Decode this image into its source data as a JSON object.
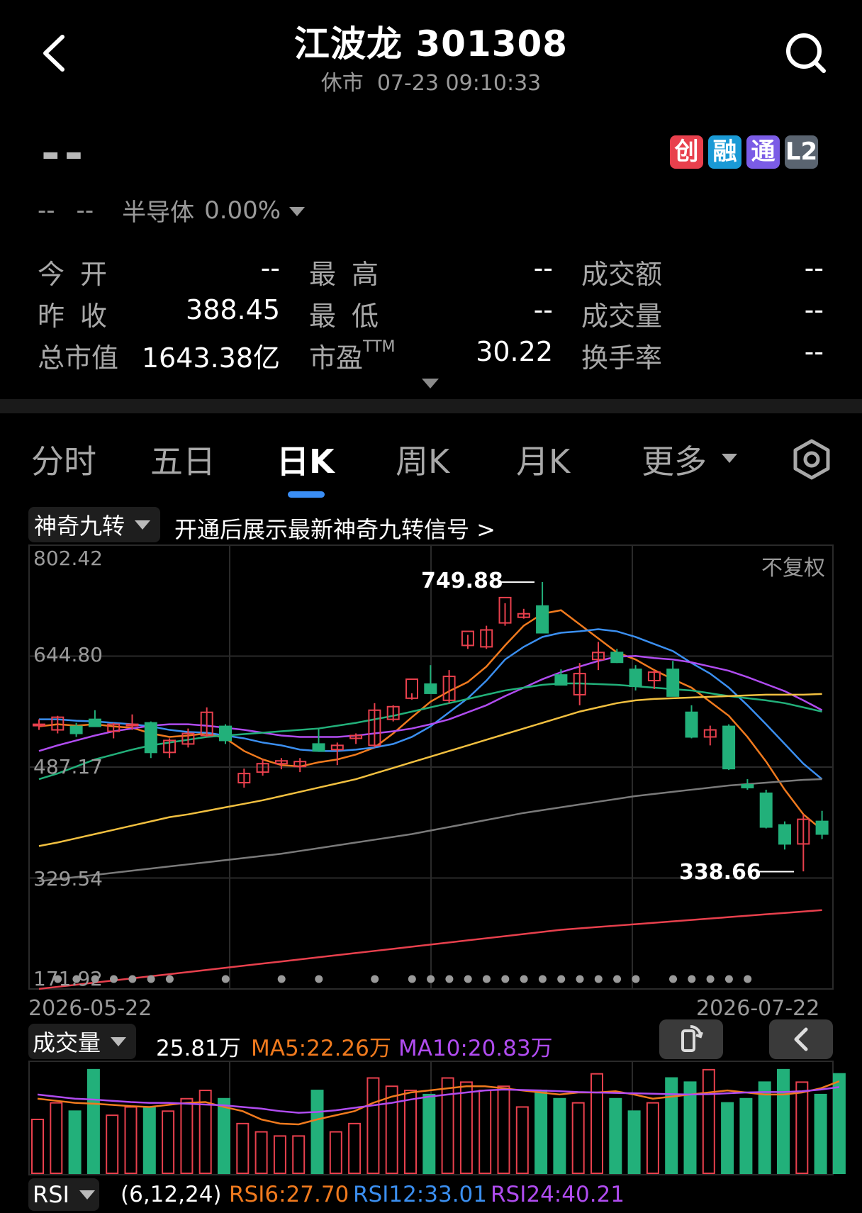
{
  "header": {
    "title": "江波龙 301308",
    "status": "休市",
    "datetime": "07-23 09:10:33"
  },
  "quote": {
    "price": "--",
    "change": "--",
    "change_pct": "--",
    "sector": "半导体",
    "sector_pct": "0.00%",
    "badges": [
      {
        "label": "创",
        "color": "#e8404d"
      },
      {
        "label": "融",
        "color": "#1a9ad6"
      },
      {
        "label": "通",
        "color": "#7b5ce6"
      },
      {
        "label": "L2",
        "color": "#5a6470"
      }
    ],
    "fields": {
      "open_label": "今开",
      "open": "--",
      "high_label": "最高",
      "high": "--",
      "amount_label": "成交额",
      "amount": "--",
      "prev_close_label": "昨收",
      "prev_close": "388.45",
      "low_label": "最低",
      "low": "--",
      "volume_label": "成交量",
      "volume": "--",
      "mktcap_label": "总市值",
      "mktcap": "1643.38亿",
      "pe_label": "市盈",
      "pe_sup": "TTM",
      "pe": "30.22",
      "turnover_label": "换手率",
      "turnover": "--"
    }
  },
  "tabs": [
    "分时",
    "五日",
    "日K",
    "周K",
    "月K",
    "更多"
  ],
  "active_tab": "日K",
  "indicator_bar": {
    "selector": "神奇九转",
    "promo": "开通后展示最新神奇九转信号 >"
  },
  "chart_data": {
    "type": "candlestick",
    "price_axis": [
      "802.42",
      "644.80",
      "487.17",
      "329.54",
      "171.92"
    ],
    "ylim": [
      171.92,
      802.42
    ],
    "adjust_label": "不复权",
    "x_start": "2026-05-22",
    "x_end": "2026-07-22",
    "max_label": "749.88",
    "min_label": "338.66",
    "candles": [
      {
        "o": 548,
        "h": 555,
        "l": 540,
        "c": 548
      },
      {
        "o": 540,
        "h": 560,
        "l": 535,
        "c": 558
      },
      {
        "o": 545,
        "h": 550,
        "l": 530,
        "c": 535
      },
      {
        "o": 555,
        "h": 568,
        "l": 545,
        "c": 545
      },
      {
        "o": 538,
        "h": 550,
        "l": 528,
        "c": 548
      },
      {
        "o": 548,
        "h": 562,
        "l": 540,
        "c": 548
      },
      {
        "o": 550,
        "h": 552,
        "l": 500,
        "c": 508
      },
      {
        "o": 508,
        "h": 528,
        "l": 500,
        "c": 525
      },
      {
        "o": 520,
        "h": 542,
        "l": 515,
        "c": 535
      },
      {
        "o": 532,
        "h": 572,
        "l": 530,
        "c": 565
      },
      {
        "o": 545,
        "h": 548,
        "l": 520,
        "c": 525
      },
      {
        "o": 465,
        "h": 485,
        "l": 458,
        "c": 478
      },
      {
        "o": 480,
        "h": 498,
        "l": 475,
        "c": 492
      },
      {
        "o": 492,
        "h": 500,
        "l": 484,
        "c": 496
      },
      {
        "o": 488,
        "h": 500,
        "l": 480,
        "c": 495
      },
      {
        "o": 520,
        "h": 542,
        "l": 512,
        "c": 510
      },
      {
        "o": 512,
        "h": 522,
        "l": 490,
        "c": 518
      },
      {
        "o": 528,
        "h": 535,
        "l": 520,
        "c": 532
      },
      {
        "o": 518,
        "h": 578,
        "l": 515,
        "c": 568
      },
      {
        "o": 555,
        "h": 575,
        "l": 552,
        "c": 573
      },
      {
        "o": 585,
        "h": 592,
        "l": 583,
        "c": 612
      },
      {
        "o": 605,
        "h": 632,
        "l": 598,
        "c": 592
      },
      {
        "o": 582,
        "h": 625,
        "l": 578,
        "c": 616
      },
      {
        "o": 660,
        "h": 675,
        "l": 655,
        "c": 680
      },
      {
        "o": 658,
        "h": 688,
        "l": 655,
        "c": 682
      },
      {
        "o": 692,
        "h": 720,
        "l": 688,
        "c": 728
      },
      {
        "o": 700,
        "h": 712,
        "l": 698,
        "c": 705
      },
      {
        "o": 716,
        "h": 750,
        "l": 680,
        "c": 678
      },
      {
        "o": 618,
        "h": 626,
        "l": 605,
        "c": 604
      },
      {
        "o": 590,
        "h": 635,
        "l": 575,
        "c": 620
      },
      {
        "o": 640,
        "h": 665,
        "l": 625,
        "c": 650
      },
      {
        "o": 650,
        "h": 655,
        "l": 635,
        "c": 636
      },
      {
        "o": 626,
        "h": 632,
        "l": 596,
        "c": 602
      },
      {
        "o": 610,
        "h": 625,
        "l": 598,
        "c": 622
      },
      {
        "o": 626,
        "h": 638,
        "l": 592,
        "c": 588
      },
      {
        "o": 565,
        "h": 575,
        "l": 528,
        "c": 530
      },
      {
        "o": 530,
        "h": 546,
        "l": 518,
        "c": 540
      },
      {
        "o": 545,
        "h": 548,
        "l": 483,
        "c": 485
      },
      {
        "o": 462,
        "h": 470,
        "l": 455,
        "c": 458
      },
      {
        "o": 450,
        "h": 455,
        "l": 400,
        "c": 402
      },
      {
        "o": 405,
        "h": 410,
        "l": 370,
        "c": 378
      },
      {
        "o": 378,
        "h": 420,
        "l": 339,
        "c": 413
      },
      {
        "o": 410,
        "h": 425,
        "l": 385,
        "c": 392
      }
    ],
    "moving_averages": [
      {
        "name": "MA5",
        "color": "#f07a1e",
        "values": [
          545,
          548,
          546,
          548,
          545,
          543,
          535,
          530,
          532,
          535,
          528,
          510,
          498,
          490,
          488,
          494,
          498,
          505,
          515,
          535,
          558,
          580,
          595,
          608,
          630,
          660,
          688,
          705,
          710,
          690,
          670,
          650,
          640,
          625,
          612,
          600,
          580,
          560,
          530,
          495,
          455,
          420,
          398
        ]
      },
      {
        "name": "MA10",
        "color": "#3b8ff0",
        "values": [
          555,
          555,
          553,
          552,
          550,
          548,
          545,
          540,
          537,
          536,
          532,
          528,
          522,
          518,
          512,
          510,
          510,
          512,
          515,
          520,
          530,
          545,
          565,
          585,
          610,
          640,
          658,
          672,
          678,
          680,
          683,
          680,
          672,
          662,
          652,
          635,
          620,
          600,
          575,
          548,
          520,
          492,
          470
        ]
      },
      {
        "name": "MA20",
        "color": "#b04cf0",
        "values": [
          510,
          518,
          525,
          532,
          538,
          542,
          546,
          548,
          548,
          546,
          543,
          540,
          536,
          532,
          530,
          530,
          530,
          532,
          535,
          538,
          542,
          548,
          555,
          565,
          575,
          588,
          600,
          612,
          622,
          630,
          638,
          644,
          645,
          642,
          640,
          636,
          630,
          624,
          615,
          605,
          595,
          582,
          568
        ]
      },
      {
        "name": "MA30",
        "color": "#22b07a",
        "values": [
          470,
          478,
          488,
          498,
          505,
          512,
          518,
          522,
          526,
          530,
          532,
          534,
          536,
          538,
          540,
          542,
          546,
          550,
          555,
          560,
          566,
          572,
          578,
          584,
          590,
          596,
          600,
          604,
          606,
          606,
          605,
          604,
          602,
          600,
          598,
          596,
          592,
          588,
          585,
          582,
          578,
          572,
          566
        ]
      },
      {
        "name": "MA60",
        "color": "#f2c040",
        "values": [
          375,
          380,
          386,
          392,
          398,
          404,
          410,
          416,
          420,
          425,
          430,
          435,
          440,
          446,
          452,
          458,
          464,
          470,
          478,
          486,
          494,
          502,
          510,
          518,
          526,
          534,
          542,
          550,
          558,
          566,
          572,
          578,
          582,
          584,
          585,
          586,
          587,
          588,
          589,
          590,
          590,
          590,
          591
        ]
      },
      {
        "name": "MA120",
        "color": "#7a7a7a",
        "values": [
          325,
          328,
          331,
          334,
          337,
          340,
          343,
          346,
          349,
          352,
          355,
          358,
          361,
          364,
          368,
          372,
          376,
          380,
          384,
          388,
          392,
          397,
          402,
          407,
          412,
          417,
          422,
          426,
          430,
          434,
          438,
          442,
          446,
          449,
          452,
          455,
          458,
          461,
          463,
          465,
          467,
          469,
          470
        ]
      },
      {
        "name": "MA250",
        "color": "#e8404d",
        "values": [
          172,
          175,
          178,
          181,
          184,
          187,
          190,
          193,
          196,
          199,
          202,
          205,
          208,
          211,
          214,
          217,
          220,
          223,
          226,
          229,
          232,
          235,
          238,
          241,
          244,
          247,
          250,
          253,
          256,
          258,
          260,
          262,
          264,
          266,
          268,
          270,
          272,
          274,
          276,
          278,
          280,
          282,
          284
        ]
      }
    ],
    "signal_dots": [
      2,
      3,
      4,
      5,
      6,
      7,
      8,
      11,
      14,
      16,
      19,
      21,
      22,
      23,
      24,
      25,
      26,
      27,
      28,
      29,
      30,
      31,
      32,
      33,
      35,
      36,
      37,
      38,
      39
    ]
  },
  "volume": {
    "selector": "成交量",
    "value": "25.81万",
    "ma5_label": "MA5:22.26万",
    "ma10_label": "MA10:20.83万",
    "bars": [
      13,
      17,
      15,
      25,
      14,
      16,
      16,
      15,
      18,
      20,
      18,
      12,
      10,
      9,
      9,
      20,
      10,
      12,
      23,
      21,
      20,
      19,
      23,
      22,
      20,
      21,
      16,
      20,
      18,
      17,
      24,
      18,
      15,
      17,
      23,
      22,
      25,
      17,
      18,
      22,
      25,
      22,
      19,
      24
    ],
    "ma5": [
      18,
      17.5,
      17,
      16.8,
      16.5,
      16.2,
      16,
      16.5,
      17,
      17.2,
      16,
      15,
      13,
      12,
      11.8,
      13,
      14,
      15,
      17,
      18.5,
      19.5,
      20,
      20.5,
      21,
      21,
      20.5,
      20,
      19.5,
      19,
      19.5,
      19.5,
      19.8,
      19,
      18,
      18.5,
      19,
      19.5,
      20,
      19.5,
      19,
      19,
      19.5,
      20.5,
      22.2
    ],
    "ma10": [
      19,
      18.5,
      18,
      17.8,
      17.5,
      17.2,
      17,
      17,
      16.8,
      16.6,
      16.4,
      16,
      15.6,
      15,
      14.6,
      14.8,
      15.2,
      15.8,
      16.4,
      17,
      17.8,
      18.5,
      19,
      19.5,
      20,
      20.2,
      20.1,
      20,
      19.8,
      19.6,
      19.5,
      19.4,
      19.3,
      19.2,
      19.1,
      19,
      19.1,
      19.3,
      19.5,
      19.6,
      19.6,
      19.8,
      20.2,
      20.8
    ]
  },
  "rsi": {
    "selector": "RSI",
    "params": "(6,12,24)",
    "rsi6": "RSI6:27.70",
    "rsi12": "RSI12:33.01",
    "rsi24": "RSI24:40.21"
  },
  "colors": {
    "up": "#e8404d",
    "down": "#22b07a",
    "grid": "#2a2a2a",
    "accent": "#3a8ef5",
    "rsi6": "#f07a1e",
    "rsi12": "#3b8ff0",
    "rsi24": "#b04cf0"
  }
}
